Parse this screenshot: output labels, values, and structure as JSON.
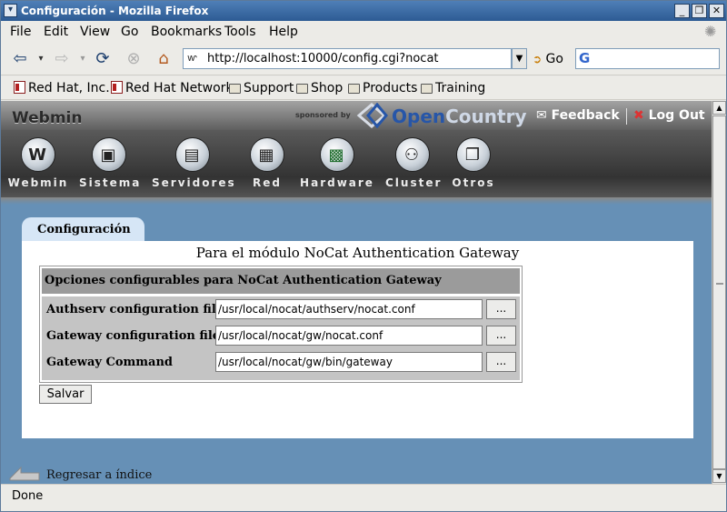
{
  "window": {
    "title": "Configuración - Mozilla Firefox"
  },
  "menu": [
    {
      "label": "File"
    },
    {
      "label": "Edit"
    },
    {
      "label": "View"
    },
    {
      "label": "Go"
    },
    {
      "label": "Bookmarks"
    },
    {
      "label": "Tools"
    },
    {
      "label": "Help"
    }
  ],
  "navigation": {
    "url": "http://localhost:10000/config.cgi?nocat",
    "go_label": "Go",
    "search_value": ""
  },
  "bookmarks": [
    {
      "label": "Red Hat, Inc.",
      "icon": "redhat-page-icon"
    },
    {
      "label": "Red Hat Network",
      "icon": "redhat-page-icon"
    },
    {
      "label": "Support",
      "icon": "folder-icon"
    },
    {
      "label": "Shop",
      "icon": "folder-icon"
    },
    {
      "label": "Products",
      "icon": "folder-icon"
    },
    {
      "label": "Training",
      "icon": "folder-icon"
    }
  ],
  "webmin": {
    "logo": "Webmin",
    "sponsored": "sponsored by",
    "sponsor_name_1": "Open",
    "sponsor_name_2": "Country",
    "feedback": "Feedback",
    "logout": "Log Out",
    "categories": [
      {
        "label": "Webmin",
        "icon": "webmin-icon"
      },
      {
        "label": "Sistema",
        "icon": "system-icon"
      },
      {
        "label": "Servidores",
        "icon": "servers-icon"
      },
      {
        "label": "Red",
        "icon": "network-icon"
      },
      {
        "label": "Hardware",
        "icon": "hardware-icon"
      },
      {
        "label": "Cluster",
        "icon": "cluster-icon"
      },
      {
        "label": "Otros",
        "icon": "others-icon"
      }
    ]
  },
  "page": {
    "tab_label": "Configuración",
    "title": "Para el módulo NoCat Authentication Gateway",
    "table_header": "Opciones configurables para NoCat Authentication Gateway",
    "rows": [
      {
        "label": "Authserv configuration file",
        "value": "/usr/local/nocat/authserv/nocat.conf",
        "button": "..."
      },
      {
        "label": "Gateway configuration file",
        "value": "/usr/local/nocat/gw/nocat.conf",
        "button": "..."
      },
      {
        "label": "Gateway Command",
        "value": "/usr/local/nocat/gw/bin/gateway",
        "button": "..."
      }
    ],
    "save_label": "Salvar",
    "back_label": "Regresar a índice"
  },
  "status": {
    "text": "Done"
  },
  "colors": {
    "content_bg": "#6690b6",
    "titlebar": "#3b6aa4",
    "table_header_bg": "#9b9b9b",
    "table_body_bg": "#c4c4c4"
  }
}
